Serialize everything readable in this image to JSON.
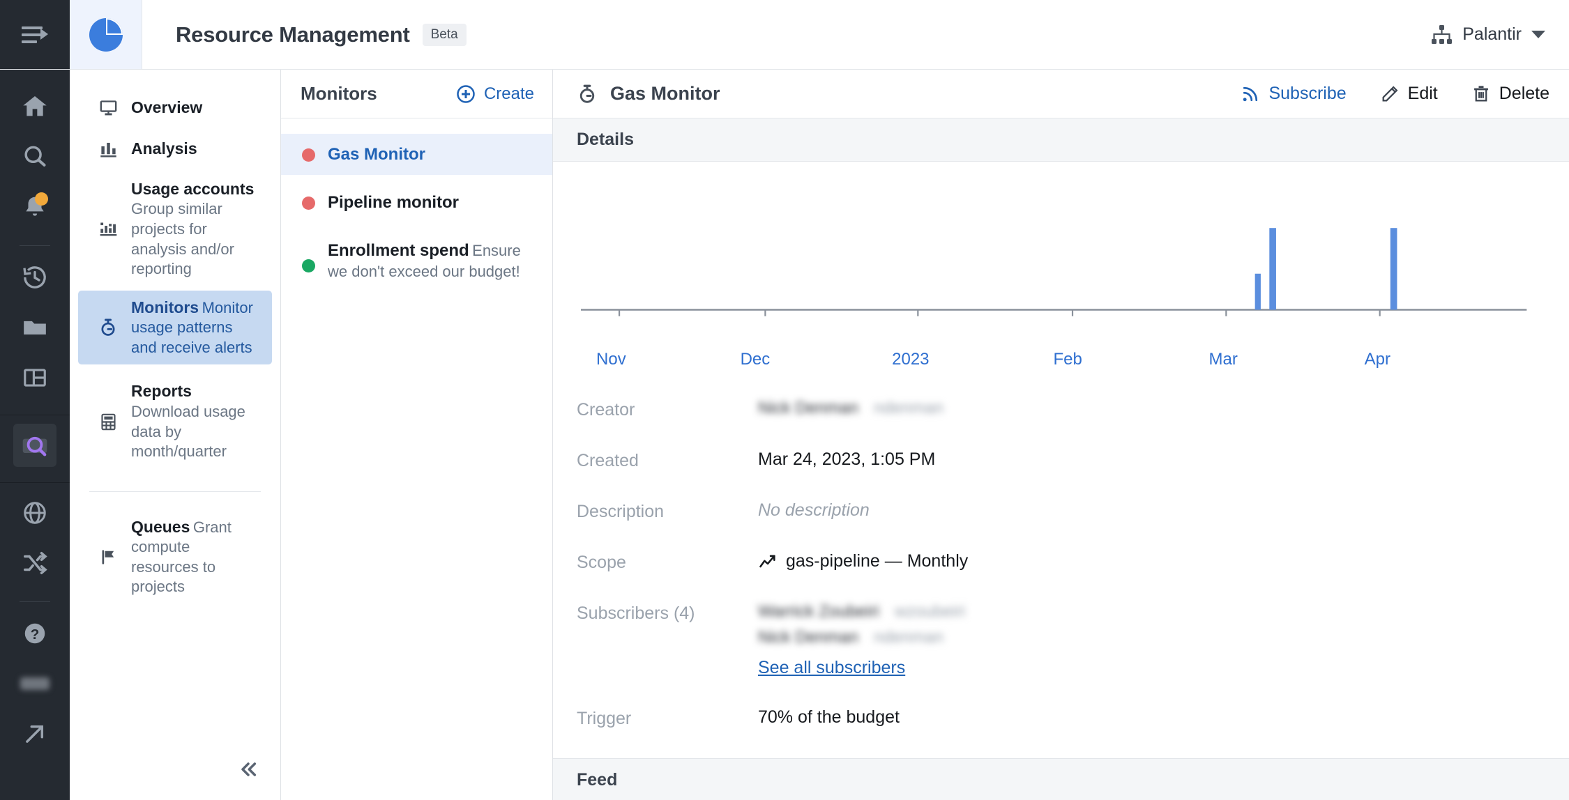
{
  "topbar": {
    "menu_icon": "hamburger-collapse-icon",
    "logo_icon": "pie-chart-logo",
    "title": "Resource Management",
    "badge": "Beta",
    "org_icon": "org-hierarchy-icon",
    "org_name": "Palantir",
    "caret_icon": "chevron-down-icon"
  },
  "rail": {
    "items": [
      {
        "icon": "home-icon",
        "active": false
      },
      {
        "icon": "search-icon",
        "active": false
      },
      {
        "icon": "notifications-bell-icon",
        "active": false,
        "badge": true
      },
      {
        "icon": "history-clock-icon",
        "active": false
      },
      {
        "icon": "folder-icon",
        "active": false
      },
      {
        "icon": "layout-panels-icon",
        "active": false
      },
      {
        "icon": "resource-search-icon",
        "active": true
      },
      {
        "icon": "globe-icon",
        "active": false
      },
      {
        "icon": "shuffle-arrows-icon",
        "active": false
      },
      {
        "icon": "help-question-icon",
        "active": false
      },
      {
        "icon": "redacted-chip",
        "active": false
      },
      {
        "icon": "external-link-arrow-icon",
        "active": false
      }
    ]
  },
  "sidebar": {
    "items": [
      {
        "icon": "monitor-display-icon",
        "title": "Overview",
        "desc": "",
        "selected": false
      },
      {
        "icon": "bar-chart-icon",
        "title": "Analysis",
        "desc": "",
        "selected": false
      },
      {
        "icon": "usage-accounts-icon",
        "title": "Usage accounts",
        "desc": "Group similar projects for analysis and/or reporting",
        "selected": false
      },
      {
        "icon": "stopwatch-icon",
        "title": "Monitors",
        "desc": "Monitor usage patterns and receive alerts",
        "selected": true
      },
      {
        "icon": "calculator-grid-icon",
        "title": "Reports",
        "desc": "Download usage data by month/quarter",
        "selected": false
      },
      {
        "icon": "flag-icon",
        "title": "Queues",
        "desc": "Grant compute resources to projects",
        "selected": false
      }
    ],
    "collapse_icon": "double-chevron-left-icon"
  },
  "monitors_panel": {
    "heading": "Monitors",
    "create_label": "Create",
    "create_icon": "plus-circle-icon",
    "items": [
      {
        "name": "Gas Monitor",
        "desc": "",
        "status_color": "#e66a6a",
        "selected": true
      },
      {
        "name": "Pipeline monitor",
        "desc": "",
        "status_color": "#e66a6a",
        "selected": false
      },
      {
        "name": "Enrollment spend",
        "desc": "Ensure we don't exceed our budget!",
        "status_color": "#1aa863",
        "selected": false
      }
    ]
  },
  "detail": {
    "icon": "stopwatch-icon",
    "title": "Gas Monitor",
    "actions": [
      {
        "label": "Subscribe",
        "icon": "rss-feed-icon",
        "style": "link"
      },
      {
        "label": "Edit",
        "icon": "pencil-icon",
        "style": "plain"
      },
      {
        "label": "Delete",
        "icon": "trash-icon",
        "style": "plain"
      }
    ],
    "details_heading": "Details",
    "feed_heading": "Feed",
    "fields": [
      {
        "key": "Creator",
        "value": "Nick Denman   ndenman",
        "redacted": true
      },
      {
        "key": "Created",
        "value": "Mar 24, 2023, 1:05 PM",
        "redacted": false
      },
      {
        "key": "Description",
        "value": "No description",
        "italic": true
      },
      {
        "key": "Scope",
        "value": "gas-pipeline — Monthly",
        "icon": "line-chart-icon"
      }
    ],
    "subscribers": {
      "key": "Subscribers (4)",
      "rows": [
        "Warrick Zoubeiri   wzoubeiri",
        "Nick Denman   ndenman"
      ],
      "link": "See all subscribers"
    },
    "trigger": {
      "key": "Trigger",
      "value": "70% of the budget"
    }
  },
  "chart_data": {
    "type": "bar",
    "title": "",
    "xlabel": "",
    "ylabel": "",
    "grid": false,
    "legend": null,
    "accent_color": "#5b8ede",
    "axis_label_color": "#2f6fd0",
    "tick_labels": [
      "Nov",
      "Dec",
      "2023",
      "Feb",
      "Mar",
      "Apr"
    ],
    "tick_positions_pct": [
      4.0,
      19.2,
      35.1,
      51.2,
      67.2,
      83.2
    ],
    "x": [
      "Nov",
      "Dec",
      "2023",
      "Feb",
      "Mar",
      "Apr"
    ],
    "bars": [
      {
        "x_pct": 70.5,
        "height_pct": 29.0
      },
      {
        "x_pct": 72.2,
        "height_pct": 66.0
      },
      {
        "x_pct": 84.0,
        "height_pct": 66.0
      }
    ],
    "values": [
      0,
      0,
      0,
      0,
      29,
      66
    ],
    "ylim": [
      0,
      100
    ],
    "note": "Sparse spike bar chart; only late-Mar and early-Apr bars are non-zero"
  }
}
